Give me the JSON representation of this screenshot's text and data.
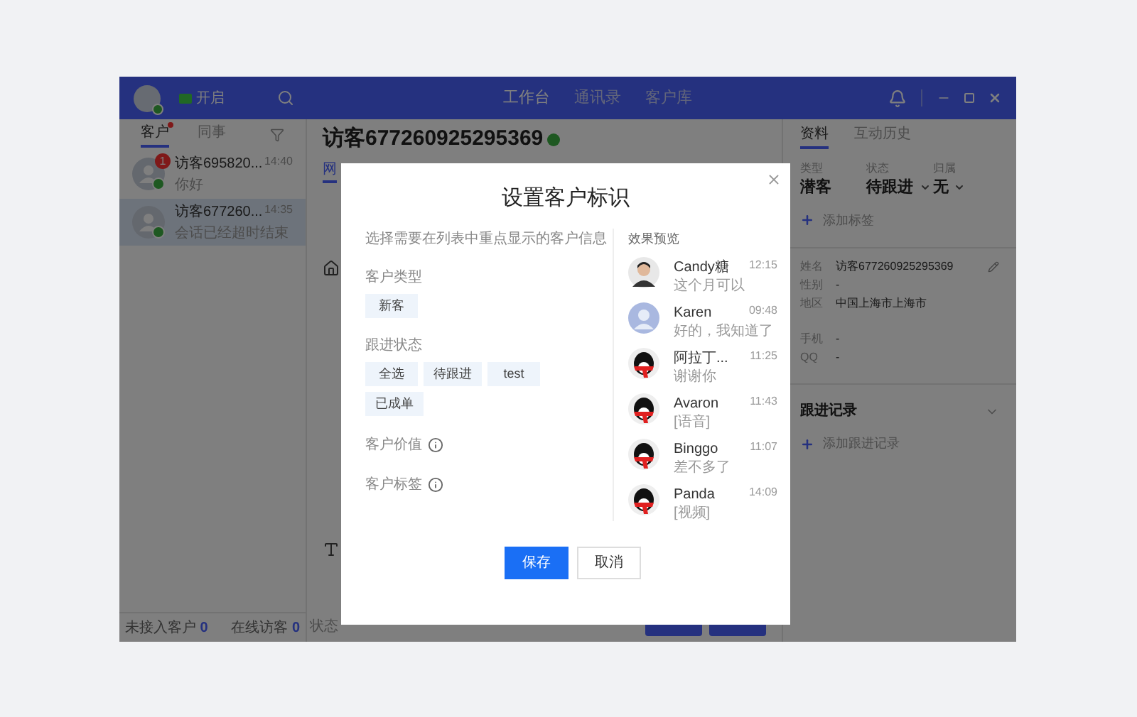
{
  "toolbar": {
    "status": "开启",
    "status_on": true,
    "nav": [
      {
        "label": "工作台",
        "selected": true
      },
      {
        "label": "通讯录",
        "selected": false
      },
      {
        "label": "客户库",
        "selected": false
      }
    ]
  },
  "left_panel": {
    "tabs": [
      {
        "label": "客户",
        "selected": true,
        "dot": true
      },
      {
        "label": "同事",
        "selected": false,
        "dot": false
      }
    ],
    "conversations": [
      {
        "name": "访客695820...",
        "time": "14:40",
        "message": "你好",
        "unread": "1",
        "selected": false
      },
      {
        "name": "访客677260...",
        "time": "14:35",
        "message": "会话已经超时结束",
        "selected": true
      }
    ],
    "footer": [
      {
        "label": "未接入客户",
        "count": "0"
      },
      {
        "label": "在线访客",
        "count": "0"
      }
    ]
  },
  "center": {
    "title": "访客677260925295369",
    "online": true,
    "tab": "网",
    "status_label": "状态"
  },
  "right_panel": {
    "tabs": [
      {
        "label": "资料",
        "selected": true
      },
      {
        "label": "互动历史",
        "selected": false
      }
    ],
    "attributes": [
      {
        "label": "类型",
        "value": "潜客",
        "dropdown": false
      },
      {
        "label": "状态",
        "value": "待跟进",
        "dropdown": true
      },
      {
        "label": "归属",
        "value": "无",
        "dropdown": true
      }
    ],
    "add_tag": "添加标签",
    "fields": [
      {
        "label": "姓名",
        "value": "访客677260925295369"
      },
      {
        "label": "性别",
        "value": "-"
      },
      {
        "label": "地区",
        "value": "中国上海市上海市"
      },
      {
        "label": "手机",
        "value": "-"
      },
      {
        "label": "QQ",
        "value": "-"
      }
    ],
    "records_title": "跟进记录",
    "add_record": "添加跟进记录"
  },
  "dialog": {
    "title": "设置客户标识",
    "description": "选择需要在列表中重点显示的客户信息",
    "sections": [
      {
        "kind": "options",
        "label": "客户类型",
        "options": [
          "新客"
        ]
      },
      {
        "kind": "options",
        "label": "跟进状态",
        "options": [
          "全选",
          "待跟进",
          "test",
          "已成单"
        ]
      },
      {
        "kind": "info",
        "label": "客户价值"
      },
      {
        "kind": "info",
        "label": "客户标签"
      }
    ],
    "preview_title": "效果预览",
    "preview": [
      {
        "kind": "photo",
        "name": "Candy糖",
        "time": "12:15",
        "message": "这个月可以"
      },
      {
        "kind": "default",
        "name": "Karen",
        "time": "09:48",
        "message": "好的，我知道了"
      },
      {
        "kind": "mascot",
        "name": "阿拉丁...",
        "time": "11:25",
        "message": "谢谢你"
      },
      {
        "kind": "mascot",
        "name": "Avaron",
        "time": "11:43",
        "message": "[语音]"
      },
      {
        "kind": "mascot",
        "name": "Binggo",
        "time": "11:07",
        "message": "差不多了"
      },
      {
        "kind": "mascot",
        "name": "Panda",
        "time": "14:09",
        "message": "[视频]"
      }
    ],
    "buttons": [
      {
        "label": "保存",
        "primary": true
      },
      {
        "label": "取消",
        "primary": false
      }
    ]
  }
}
